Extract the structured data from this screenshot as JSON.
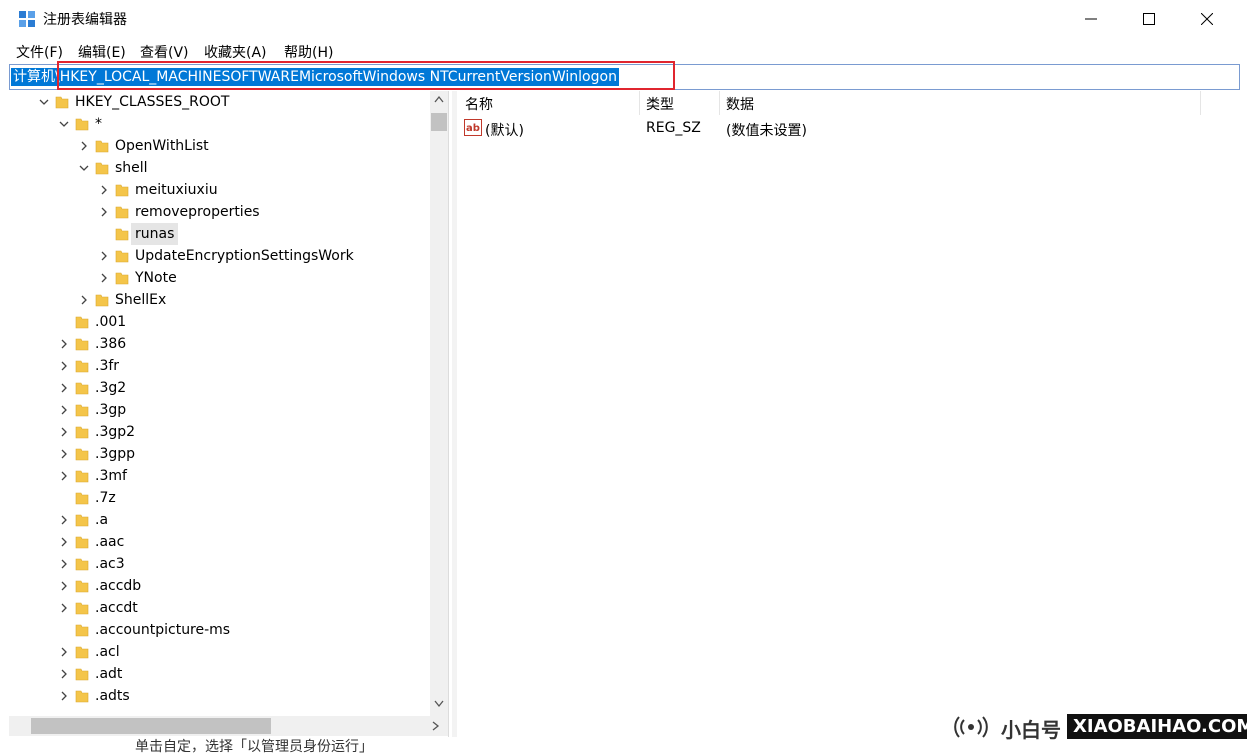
{
  "window": {
    "title": "注册表编辑器"
  },
  "menu": [
    "文件(F)",
    "编辑(E)",
    "查看(V)",
    "收藏夹(A)",
    "帮助(H)"
  ],
  "address": {
    "root": "计算机",
    "path": "HKEY_LOCAL_MACHINESOFTWAREMicrosoftWindows NTCurrentVersionWinlogon"
  },
  "tree": [
    {
      "label": "HKEY_CLASSES_ROOT",
      "depth": 0,
      "state": "open",
      "folder_open": true
    },
    {
      "label": "*",
      "depth": 1,
      "state": "open",
      "folder_open": true
    },
    {
      "label": "OpenWithList",
      "depth": 2,
      "state": "closed"
    },
    {
      "label": "shell",
      "depth": 2,
      "state": "open",
      "folder_open": true
    },
    {
      "label": "meituxiuxiu",
      "depth": 3,
      "state": "closed"
    },
    {
      "label": "removeproperties",
      "depth": 3,
      "state": "closed"
    },
    {
      "label": "runas",
      "depth": 3,
      "state": "none",
      "selected": true
    },
    {
      "label": "UpdateEncryptionSettingsWork",
      "depth": 3,
      "state": "closed"
    },
    {
      "label": "YNote",
      "depth": 3,
      "state": "closed"
    },
    {
      "label": "ShellEx",
      "depth": 2,
      "state": "closed"
    },
    {
      "label": ".001",
      "depth": 1,
      "state": "none"
    },
    {
      "label": ".386",
      "depth": 1,
      "state": "closed"
    },
    {
      "label": ".3fr",
      "depth": 1,
      "state": "closed"
    },
    {
      "label": ".3g2",
      "depth": 1,
      "state": "closed"
    },
    {
      "label": ".3gp",
      "depth": 1,
      "state": "closed"
    },
    {
      "label": ".3gp2",
      "depth": 1,
      "state": "closed"
    },
    {
      "label": ".3gpp",
      "depth": 1,
      "state": "closed"
    },
    {
      "label": ".3mf",
      "depth": 1,
      "state": "closed"
    },
    {
      "label": ".7z",
      "depth": 1,
      "state": "none"
    },
    {
      "label": ".a",
      "depth": 1,
      "state": "closed"
    },
    {
      "label": ".aac",
      "depth": 1,
      "state": "closed"
    },
    {
      "label": ".ac3",
      "depth": 1,
      "state": "closed"
    },
    {
      "label": ".accdb",
      "depth": 1,
      "state": "closed"
    },
    {
      "label": ".accdt",
      "depth": 1,
      "state": "closed"
    },
    {
      "label": ".accountpicture-ms",
      "depth": 1,
      "state": "none"
    },
    {
      "label": ".acl",
      "depth": 1,
      "state": "closed"
    },
    {
      "label": ".adt",
      "depth": 1,
      "state": "closed"
    },
    {
      "label": ".adts",
      "depth": 1,
      "state": "closed"
    }
  ],
  "list": {
    "columns": [
      "名称",
      "类型",
      "数据"
    ],
    "rows": [
      {
        "name": "(默认)",
        "type": "REG_SZ",
        "data": "(数值未设置)"
      }
    ]
  },
  "watermark": {
    "text": "小白号",
    "domain": "XIAOBAIHAO.COM"
  },
  "caption": "单击自定，选择「以管理员身份运行」",
  "colors": {
    "selection": "#0078d7",
    "highlight_box": "#e0252f",
    "folder": "#f4c54a"
  }
}
